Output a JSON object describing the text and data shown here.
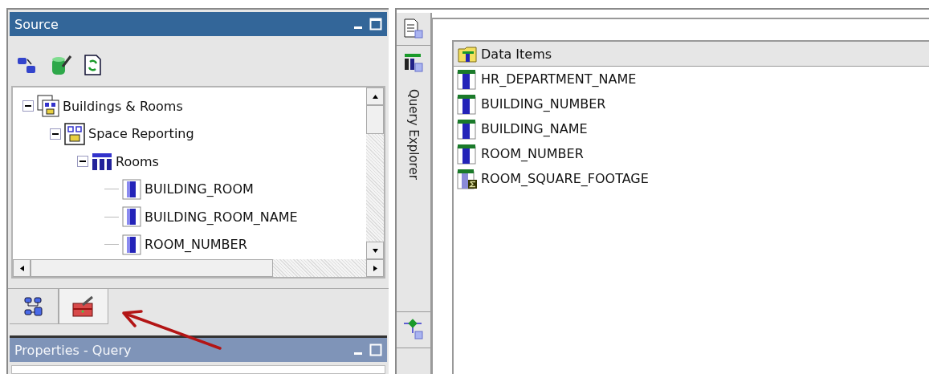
{
  "source_panel": {
    "title": "Source",
    "tree": [
      {
        "label": "Buildings & Rooms",
        "kind": "package",
        "expanded": true,
        "children": [
          {
            "label": "Space Reporting",
            "kind": "namespace",
            "expanded": true,
            "children": [
              {
                "label": "Rooms",
                "kind": "query_subject",
                "expanded": true,
                "children": [
                  {
                    "label": "BUILDING_ROOM",
                    "kind": "column"
                  },
                  {
                    "label": "BUILDING_ROOM_NAME",
                    "kind": "column"
                  },
                  {
                    "label": "ROOM_NUMBER",
                    "kind": "column"
                  }
                ]
              }
            ]
          }
        ]
      }
    ],
    "tabs": [
      {
        "kind": "source",
        "selected": false
      },
      {
        "kind": "toolbox",
        "selected": true
      }
    ]
  },
  "properties_panel": {
    "title": "Properties - Query"
  },
  "query_explorer": {
    "label": "Query Explorer"
  },
  "data_items": {
    "header": "Data Items",
    "items": [
      {
        "label": "HR_DEPARTMENT_NAME",
        "kind": "column"
      },
      {
        "label": "BUILDING_NUMBER",
        "kind": "column"
      },
      {
        "label": "BUILDING_NAME",
        "kind": "column"
      },
      {
        "label": "ROOM_NUMBER",
        "kind": "column"
      },
      {
        "label": "ROOM_SQUARE_FOOTAGE",
        "kind": "calculated"
      }
    ]
  }
}
